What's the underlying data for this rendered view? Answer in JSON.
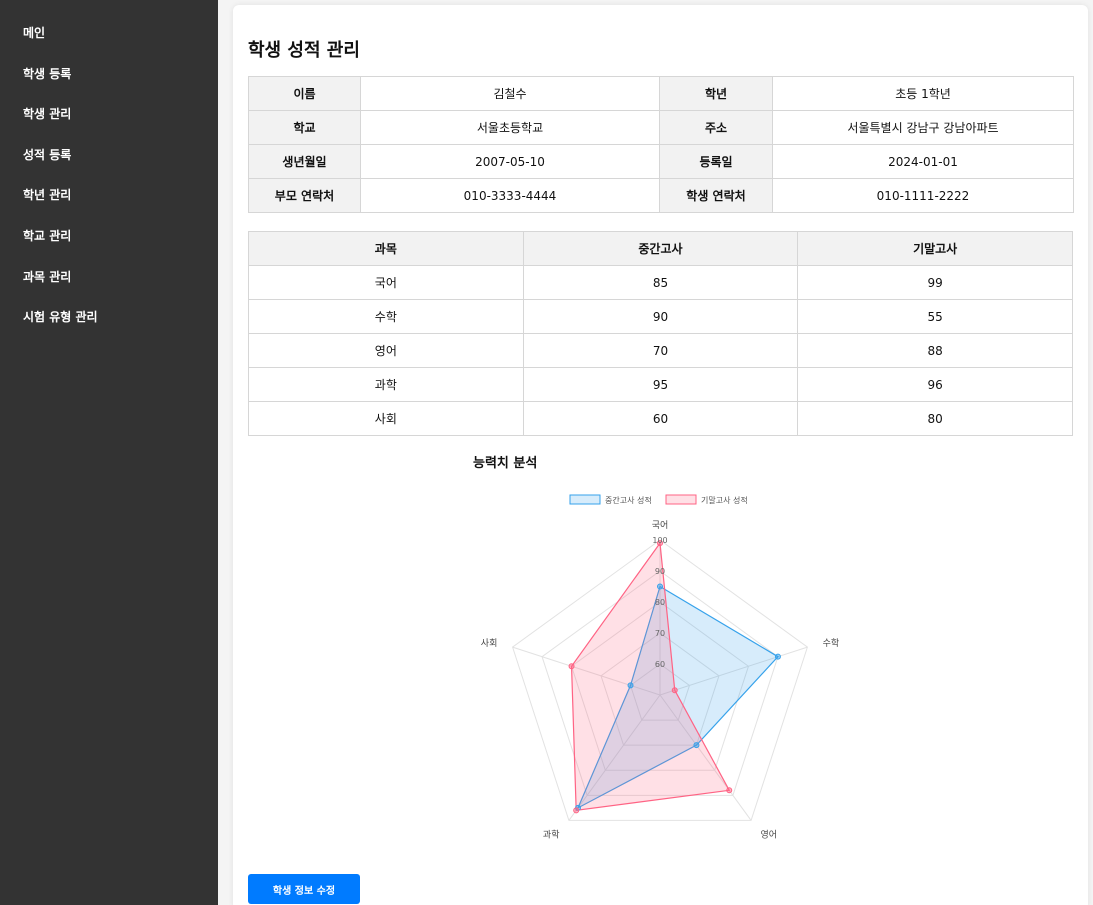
{
  "sidebar": {
    "items": [
      {
        "label": "메인"
      },
      {
        "label": "학생 등록"
      },
      {
        "label": "학생 관리"
      },
      {
        "label": "성적 등록"
      },
      {
        "label": "학년 관리"
      },
      {
        "label": "학교 관리"
      },
      {
        "label": "과목 관리"
      },
      {
        "label": "시험 유형 관리"
      }
    ]
  },
  "page": {
    "title": "학생 성적 관리"
  },
  "student_info": {
    "rows": [
      {
        "label1": "이름",
        "value1": "김철수",
        "label2": "학년",
        "value2": "초등 1학년"
      },
      {
        "label1": "학교",
        "value1": "서울초등학교",
        "label2": "주소",
        "value2": "서울특별시 강남구 강남아파트"
      },
      {
        "label1": "생년월일",
        "value1": "2007-05-10",
        "label2": "등록일",
        "value2": "2024-01-01"
      },
      {
        "label1": "부모 연락처",
        "value1": "010-3333-4444",
        "label2": "학생 연락처",
        "value2": "010-1111-2222"
      }
    ]
  },
  "scores": {
    "headers": [
      "과목",
      "중간고사",
      "기말고사"
    ],
    "rows": [
      {
        "subject": "국어",
        "midterm": "85",
        "final": "99"
      },
      {
        "subject": "수학",
        "midterm": "90",
        "final": "55"
      },
      {
        "subject": "영어",
        "midterm": "70",
        "final": "88"
      },
      {
        "subject": "과학",
        "midterm": "95",
        "final": "96"
      },
      {
        "subject": "사회",
        "midterm": "60",
        "final": "80"
      }
    ]
  },
  "chart_title": "능력치 분석",
  "chart_data": {
    "type": "radar",
    "categories": [
      "국어",
      "수학",
      "영어",
      "과학",
      "사회"
    ],
    "series": [
      {
        "name": "중간고사 성적",
        "values": [
          85,
          90,
          70,
          95,
          60
        ],
        "color": "#36a2eb"
      },
      {
        "name": "기말고사 성적",
        "values": [
          99,
          55,
          88,
          96,
          80
        ],
        "color": "#ff6384"
      }
    ],
    "r_min": 50,
    "r_max": 100,
    "ticks": [
      "60",
      "70",
      "80",
      "90",
      "100"
    ],
    "legend_position": "top"
  },
  "actions": {
    "edit_label": "학생 정보 수정"
  }
}
